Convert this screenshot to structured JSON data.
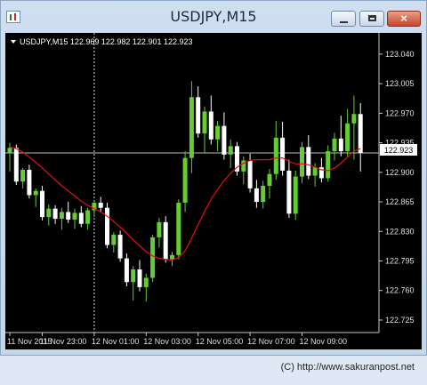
{
  "window": {
    "title": "USDJPY,M15",
    "close_label": "×"
  },
  "chart": {
    "header": "USDJPY,M15  122.969 122.982 122.901 122.923",
    "current_price_label": "122.923",
    "colors": {
      "background": "#000000",
      "bull": "#66cc33",
      "bear": "#ffffff",
      "ma": "#e01010",
      "axis": "#c8c8c8"
    }
  },
  "chart_data": {
    "type": "candlestick",
    "symbol": "USDJPY",
    "timeframe": "M15",
    "ylim": [
      122.716,
      123.052
    ],
    "y_ticks": [
      123.04,
      123.005,
      122.97,
      122.935,
      122.9,
      122.865,
      122.83,
      122.795,
      122.76,
      122.725
    ],
    "x_ticks": [
      "11 Nov 2015",
      "11 Nov 23:00",
      "12 Nov 01:00",
      "12 Nov 03:00",
      "12 Nov 05:00",
      "12 Nov 07:00",
      "12 Nov 09:00"
    ],
    "current_price": 122.923,
    "crosshair_at": "11 Nov 23:00",
    "last_bar_ohlc": {
      "open": 122.969,
      "high": 122.982,
      "low": 122.901,
      "close": 122.923
    },
    "candles": [
      [
        122.923,
        122.935,
        122.901,
        122.929
      ],
      [
        122.929,
        122.933,
        122.885,
        122.889
      ],
      [
        122.889,
        122.905,
        122.881,
        122.903
      ],
      [
        122.903,
        122.909,
        122.869,
        122.873
      ],
      [
        122.873,
        122.881,
        122.859,
        122.878
      ],
      [
        122.878,
        122.884,
        122.843,
        122.847
      ],
      [
        122.847,
        122.862,
        122.837,
        122.857
      ],
      [
        122.857,
        122.861,
        122.839,
        122.845
      ],
      [
        122.845,
        122.858,
        122.832,
        122.853
      ],
      [
        122.853,
        122.865,
        122.84,
        122.844
      ],
      [
        122.844,
        122.857,
        122.833,
        122.852
      ],
      [
        122.852,
        122.86,
        122.835,
        122.839
      ],
      [
        122.839,
        122.858,
        122.832,
        122.855
      ],
      [
        122.855,
        122.866,
        122.847,
        122.864
      ],
      [
        122.864,
        122.871,
        122.853,
        122.858
      ],
      [
        122.858,
        122.864,
        122.81,
        122.814
      ],
      [
        122.814,
        122.829,
        122.805,
        122.826
      ],
      [
        122.826,
        122.831,
        122.794,
        122.798
      ],
      [
        122.798,
        122.804,
        122.765,
        122.77
      ],
      [
        122.77,
        122.789,
        122.748,
        122.785
      ],
      [
        122.785,
        122.796,
        122.759,
        122.764
      ],
      [
        122.764,
        122.78,
        122.747,
        122.775
      ],
      [
        122.775,
        122.826,
        122.77,
        122.823
      ],
      [
        122.823,
        122.846,
        122.811,
        122.841
      ],
      [
        122.841,
        122.848,
        122.793,
        122.797
      ],
      [
        122.797,
        122.806,
        122.789,
        122.802
      ],
      [
        122.802,
        122.868,
        122.797,
        122.864
      ],
      [
        122.864,
        122.925,
        122.853,
        122.917
      ],
      [
        122.917,
        123.008,
        122.899,
        122.989
      ],
      [
        122.989,
        123.002,
        122.941,
        122.946
      ],
      [
        122.946,
        122.978,
        122.923,
        122.972
      ],
      [
        122.972,
        122.991,
        122.933,
        122.939
      ],
      [
        122.939,
        122.961,
        122.925,
        122.955
      ],
      [
        122.955,
        122.971,
        122.915,
        122.921
      ],
      [
        122.921,
        122.939,
        122.905,
        122.931
      ],
      [
        122.931,
        122.936,
        122.896,
        122.901
      ],
      [
        122.901,
        122.919,
        122.886,
        122.914
      ],
      [
        122.914,
        122.922,
        122.876,
        122.881
      ],
      [
        122.881,
        122.891,
        122.858,
        122.865
      ],
      [
        122.865,
        122.89,
        122.857,
        122.884
      ],
      [
        122.884,
        122.904,
        122.869,
        122.898
      ],
      [
        122.898,
        122.961,
        122.891,
        122.941
      ],
      [
        122.941,
        122.96,
        122.896,
        122.902
      ],
      [
        122.902,
        122.915,
        122.846,
        122.851
      ],
      [
        122.851,
        122.902,
        122.844,
        122.895
      ],
      [
        122.895,
        122.936,
        122.887,
        122.93
      ],
      [
        122.93,
        122.944,
        122.892,
        122.896
      ],
      [
        122.896,
        122.911,
        122.883,
        122.906
      ],
      [
        122.906,
        122.917,
        122.888,
        122.893
      ],
      [
        122.893,
        122.932,
        122.889,
        122.925
      ],
      [
        122.925,
        122.947,
        122.914,
        122.94
      ],
      [
        122.94,
        122.967,
        122.919,
        122.925
      ],
      [
        122.925,
        122.975,
        122.919,
        122.958
      ],
      [
        122.958,
        122.991,
        122.915,
        122.969
      ],
      [
        122.969,
        122.982,
        122.901,
        122.923
      ]
    ],
    "ma_values": [
      122.93,
      122.928,
      122.924,
      122.918,
      122.912,
      122.905,
      122.898,
      122.891,
      122.884,
      122.878,
      122.872,
      122.866,
      122.861,
      122.857,
      122.853,
      122.848,
      122.842,
      122.835,
      122.828,
      122.82,
      122.813,
      122.806,
      122.801,
      122.798,
      122.797,
      122.796,
      122.799,
      122.807,
      122.822,
      122.838,
      122.854,
      122.868,
      122.88,
      122.89,
      122.899,
      122.906,
      122.911,
      122.914,
      122.915,
      122.915,
      122.915,
      122.917,
      122.917,
      122.913,
      122.91,
      122.91,
      122.909,
      122.906,
      122.903,
      122.902,
      122.905,
      122.911,
      122.918,
      122.925,
      122.928
    ]
  },
  "footer": {
    "credit": "(C) http://www.sakuranpost.net"
  }
}
